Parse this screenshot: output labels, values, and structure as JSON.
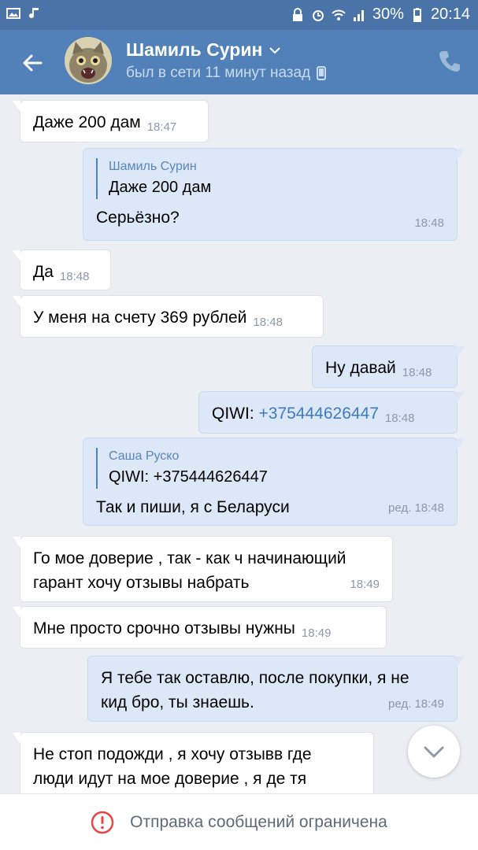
{
  "status_bar": {
    "battery": "30%",
    "time": "20:14"
  },
  "header": {
    "name": "Шамиль Сурин",
    "status": "был в сети 11 минут назад"
  },
  "messages": [
    {
      "dir": "in",
      "text": "Даже 200 дам",
      "time": "18:47"
    },
    {
      "dir": "out",
      "quote_name": "Шамиль Сурин",
      "quote_text": "Даже 200 дам",
      "text": "Серьёзно?",
      "time": "18:48"
    },
    {
      "dir": "in",
      "text": "Да",
      "time": "18:48"
    },
    {
      "dir": "in",
      "text": "У меня на счету 369 рублей",
      "time": "18:48"
    },
    {
      "dir": "out",
      "text": "Ну давай",
      "time": "18:48"
    },
    {
      "dir": "out",
      "prefix": "QIWI: ",
      "link": "+375444626447",
      "time": "18:48"
    },
    {
      "dir": "out",
      "quote_name": "Саша Руско",
      "quote_text": "QIWI: +375444626447",
      "text": "Так и пиши, я с Беларуси",
      "time": "ред. 18:48"
    },
    {
      "dir": "in",
      "line1": "Го мое доверие , так - как ч начинающий",
      "line2": "гарант хочу отзывы набрать",
      "time": "18:49"
    },
    {
      "dir": "in",
      "text": "Мне просто срочно отзывы нужны",
      "time": "18:49"
    },
    {
      "dir": "out",
      "line1": "Я тебе так оставлю, после покупки, я не",
      "line2": "кид бро, ты знаешь.",
      "time": "ред. 18:49"
    },
    {
      "dir": "in",
      "line1": "Не стоп подожди , я хочу отзывв где",
      "line2": "люди идут на мое доверие , я де тя"
    }
  ],
  "bottom": {
    "text": "Отправка сообщений ограничена"
  },
  "colors": {
    "header": "#5181b8",
    "statusbar": "#4a74a8",
    "out_bubble": "#dce8f7",
    "in_bubble": "#ffffff",
    "link": "#3f7ac0",
    "warning": "#e64646"
  }
}
